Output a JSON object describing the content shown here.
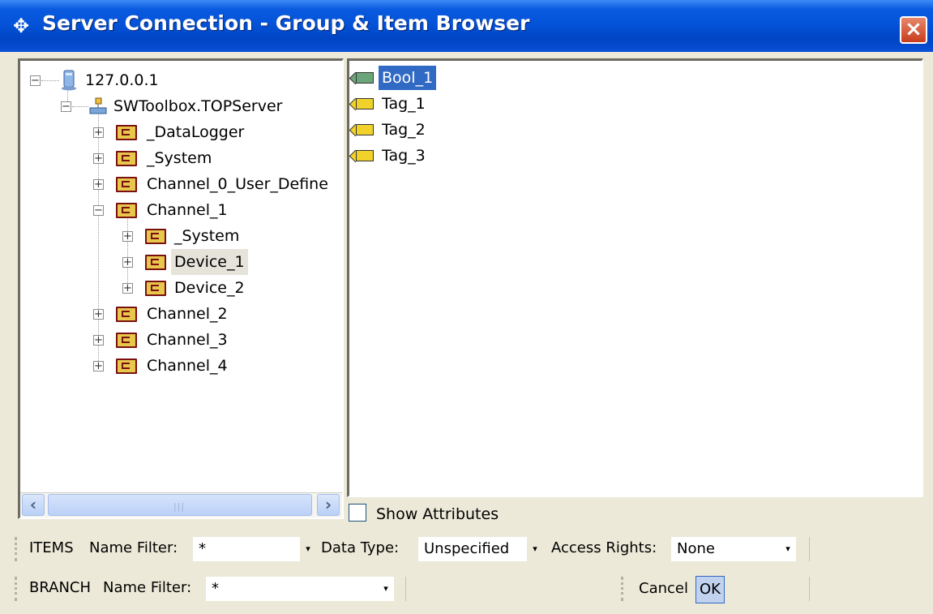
{
  "window": {
    "title": "Server Connection - Group & Item Browser",
    "close_glyph": "×",
    "title_icon": "server-connection-icon"
  },
  "tree": {
    "nodes": [
      {
        "label": "127.0.0.1",
        "icon": "computer-icon",
        "expander": "−"
      },
      {
        "label": "SWToolbox.TOPServer",
        "icon": "server-icon",
        "expander": "−"
      },
      {
        "label": "_DataLogger",
        "icon": "folder-icon",
        "expander": "+"
      },
      {
        "label": "_System",
        "icon": "folder-icon",
        "expander": "+"
      },
      {
        "label": "Channel_0_User_Define",
        "icon": "folder-icon",
        "expander": "+"
      },
      {
        "label": "Channel_1",
        "icon": "folder-icon",
        "expander": "−"
      },
      {
        "label": "_System",
        "icon": "folder-icon",
        "expander": "+"
      },
      {
        "label": "Device_1",
        "icon": "folder-icon",
        "expander": "+",
        "selected": true
      },
      {
        "label": "Device_2",
        "icon": "folder-icon",
        "expander": "+"
      },
      {
        "label": "Channel_2",
        "icon": "folder-icon",
        "expander": "+"
      },
      {
        "label": "Channel_3",
        "icon": "folder-icon",
        "expander": "+"
      },
      {
        "label": "Channel_4",
        "icon": "folder-icon",
        "expander": "+"
      }
    ],
    "scroll_left": "‹",
    "scroll_right": "›",
    "scroll_grip": "|||"
  },
  "items": [
    {
      "label": "Bool_1",
      "selected": true,
      "icon": "boolean-tag-icon"
    },
    {
      "label": "Tag_1",
      "icon": "tag-icon"
    },
    {
      "label": "Tag_2",
      "icon": "tag-icon"
    },
    {
      "label": "Tag_3",
      "icon": "tag-icon"
    }
  ],
  "show_attributes": {
    "label": "Show Attributes",
    "checked": false
  },
  "items_toolbar": {
    "section_label": "ITEMS",
    "name_filter_label": "Name Filter:",
    "name_filter_value": "*",
    "data_type_label": "Data Type:",
    "data_type_value": "Unspecified",
    "access_rights_label": "Access Rights:",
    "access_rights_value": "None",
    "dropdown_glyph": "▾"
  },
  "branch_toolbar": {
    "section_label": "BRANCH",
    "name_filter_label": "Name Filter:",
    "name_filter_value": "*",
    "dropdown_glyph": "▾",
    "cancel_label": "Cancel",
    "ok_label": "OK"
  },
  "colors": {
    "title_bar": "#0453d9",
    "selection": "#316ac5",
    "dialog_face": "#ece9d8",
    "folder_fill": "#e8c84c",
    "tag_fill": "#f1d22a"
  }
}
